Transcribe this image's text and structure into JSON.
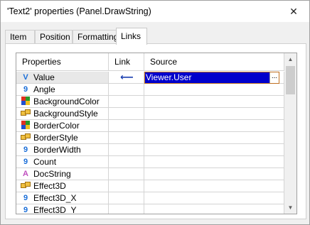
{
  "window": {
    "title": "'Text2' properties (Panel.DrawString)",
    "close_label": "✕"
  },
  "tabs": [
    {
      "label": "Item",
      "active": false
    },
    {
      "label": "Position",
      "active": false
    },
    {
      "label": "Formatting",
      "active": false
    },
    {
      "label": "Links",
      "active": true
    }
  ],
  "grid": {
    "headers": {
      "properties": "Properties",
      "link": "Link",
      "source": "Source"
    },
    "rows": [
      {
        "icon": "v-icon",
        "glyph": "V",
        "color": "#1a6ed8",
        "name": "Value",
        "link_arrow": "⟵",
        "source": "Viewer.User",
        "selected": true,
        "ellipsis": "..."
      },
      {
        "icon": "number-icon",
        "glyph": "9",
        "color": "#1a6ed8",
        "name": "Angle"
      },
      {
        "icon": "color-icon",
        "glyph": "",
        "color": "#1a6ed8",
        "name": "BackgroundColor"
      },
      {
        "icon": "style-icon",
        "glyph": "",
        "color": "#d49a1a",
        "name": "BackgroundStyle"
      },
      {
        "icon": "color-icon",
        "glyph": "",
        "color": "#1a6ed8",
        "name": "BorderColor"
      },
      {
        "icon": "style-icon",
        "glyph": "",
        "color": "#d49a1a",
        "name": "BorderStyle"
      },
      {
        "icon": "number-icon",
        "glyph": "9",
        "color": "#1a6ed8",
        "name": "BorderWidth"
      },
      {
        "icon": "number-icon",
        "glyph": "9",
        "color": "#1a6ed8",
        "name": "Count"
      },
      {
        "icon": "text-icon",
        "glyph": "A",
        "color": "#c050c0",
        "name": "DocString"
      },
      {
        "icon": "style-icon",
        "glyph": "",
        "color": "#d49a1a",
        "name": "Effect3D"
      },
      {
        "icon": "number-icon",
        "glyph": "9",
        "color": "#1a6ed8",
        "name": "Effect3D_X"
      },
      {
        "icon": "number-icon",
        "glyph": "9",
        "color": "#1a6ed8",
        "name": "Effect3D_Y"
      }
    ]
  },
  "scrollbar": {
    "up_arrow": "▲",
    "down_arrow": "▼"
  }
}
